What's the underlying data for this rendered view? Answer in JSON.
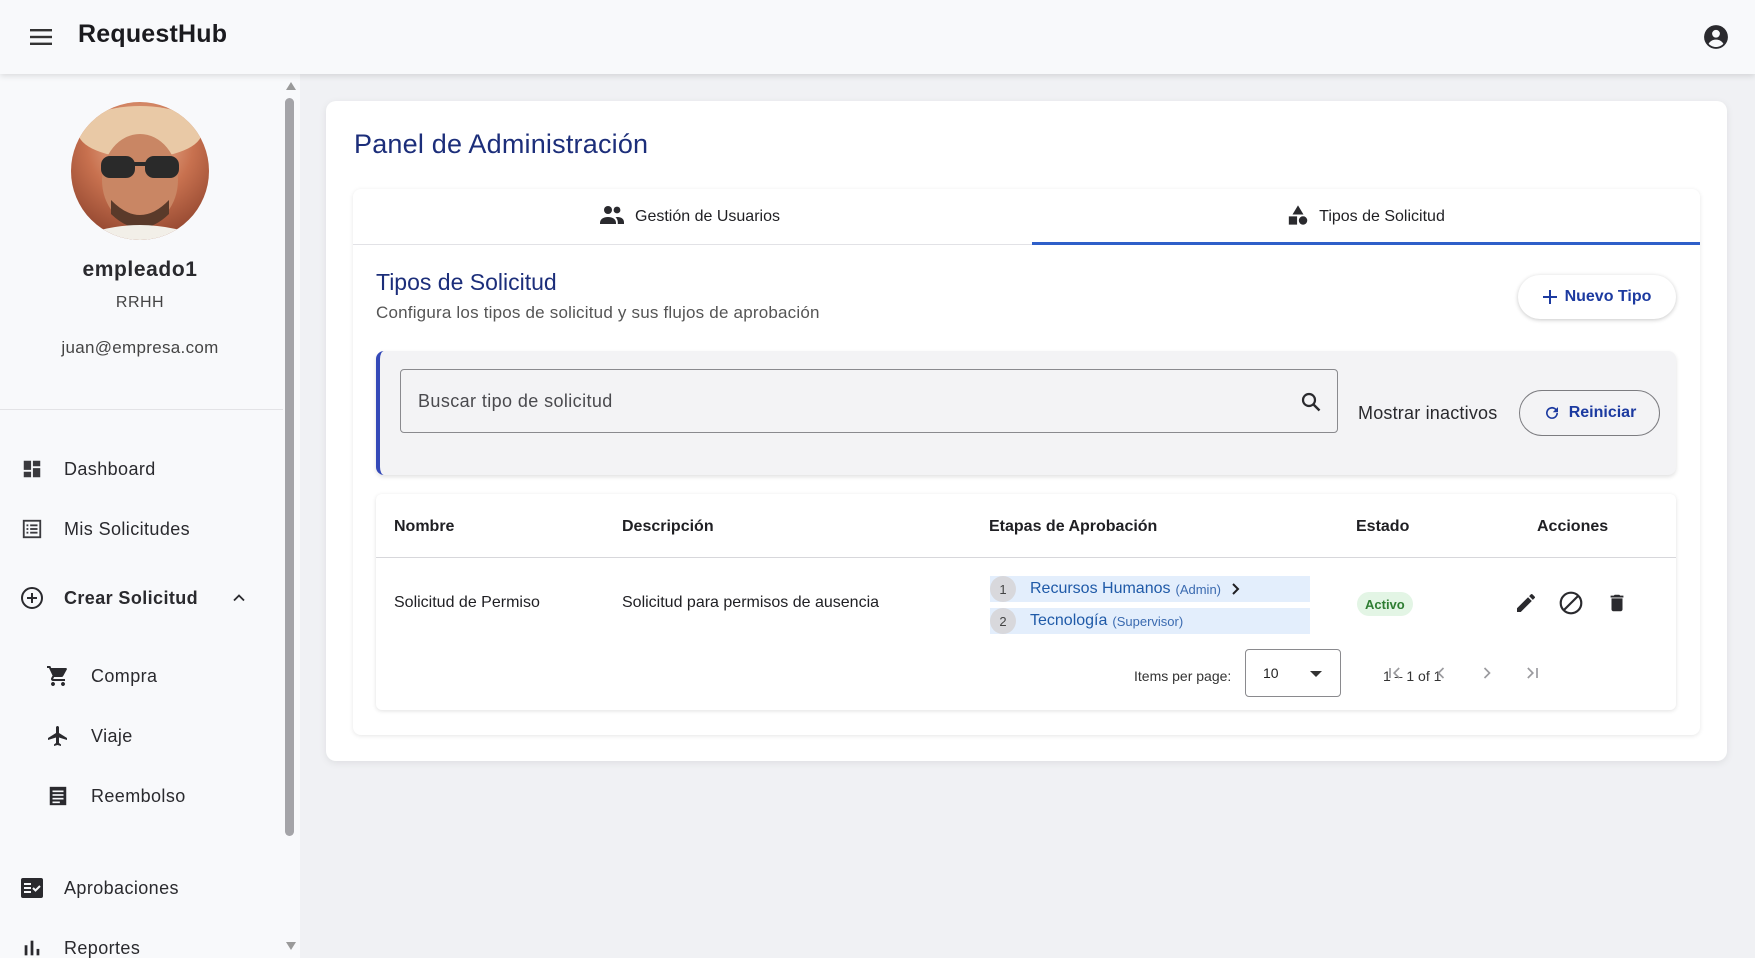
{
  "app": {
    "title": "RequestHub"
  },
  "user": {
    "name": "empleado1",
    "department": "RRHH",
    "email": "juan@empresa.com"
  },
  "sidebar": {
    "items": [
      {
        "label": "Dashboard",
        "icon": "dashboard-icon"
      },
      {
        "label": "Mis Solicitudes",
        "icon": "list-icon"
      },
      {
        "label": "Crear Solicitud",
        "icon": "add-circle-icon",
        "expanded": true
      },
      {
        "label": "Compra",
        "icon": "cart-icon"
      },
      {
        "label": "Viaje",
        "icon": "airplane-icon"
      },
      {
        "label": "Reembolso",
        "icon": "receipt-icon"
      },
      {
        "label": "Aprobaciones",
        "icon": "checklist-icon"
      },
      {
        "label": "Reportes",
        "icon": "bar-chart-icon"
      }
    ]
  },
  "main": {
    "title": "Panel de Administración",
    "tabs": [
      {
        "label": "Gestión de Usuarios",
        "icon": "people-icon",
        "active": false
      },
      {
        "label": "Tipos de Solicitud",
        "icon": "category-icon",
        "active": true
      }
    ],
    "section": {
      "title": "Tipos de Solicitud",
      "subtitle": "Configura los tipos de solicitud y sus flujos de aprobación",
      "new_button": "Nuevo Tipo"
    },
    "filters": {
      "search_placeholder": "Buscar tipo de solicitud",
      "show_inactive_label": "Mostrar inactivos",
      "reset_button": "Reiniciar"
    },
    "table": {
      "columns": [
        "Nombre",
        "Descripción",
        "Etapas de Aprobación",
        "Estado",
        "Acciones"
      ],
      "rows": [
        {
          "name": "Solicitud de Permiso",
          "description": "Solicitud para permisos de ausencia",
          "stages": [
            {
              "number": "1",
              "name": "Recursos Humanos",
              "role": "(Admin)"
            },
            {
              "number": "2",
              "name": "Tecnología",
              "role": "(Supervisor)"
            }
          ],
          "status": "Activo"
        }
      ]
    },
    "pagination": {
      "items_per_page_label": "Items per page:",
      "items_per_page": "10",
      "range": "1 – 1 of 1"
    }
  },
  "colors": {
    "primary": "#1c2e7a",
    "accent": "#2f5fc9",
    "link": "#1f5aa8",
    "active_badge_bg": "#e3f5e5",
    "active_badge_text": "#2e7d32"
  }
}
